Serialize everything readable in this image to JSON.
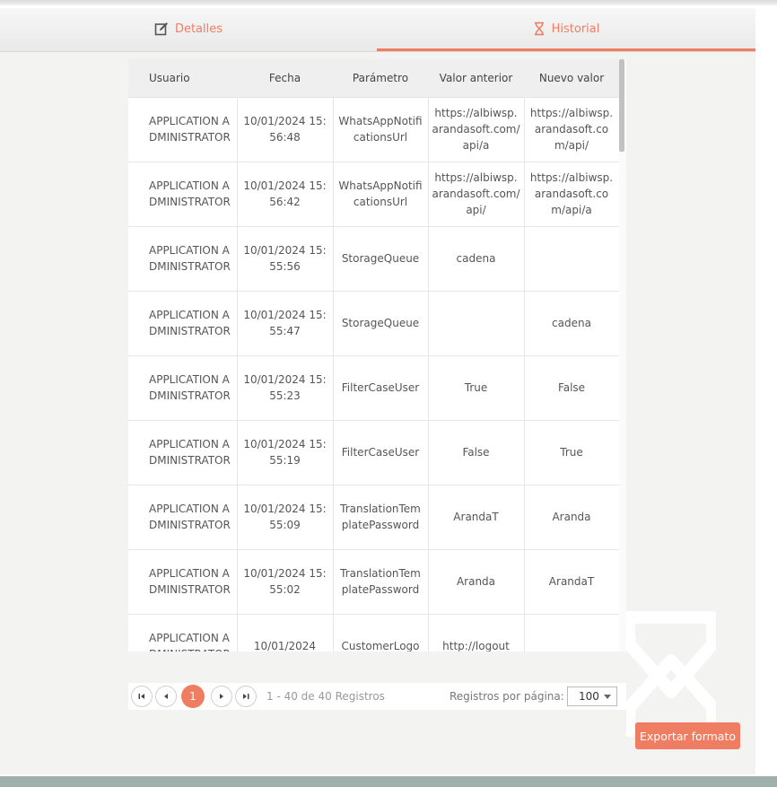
{
  "tabs": [
    {
      "label": "Detalles",
      "icon": "edit-icon"
    },
    {
      "label": "Historial",
      "icon": "hourglass-icon"
    }
  ],
  "colors": {
    "accent": "#ef7d62",
    "footer": "#9eb1ad"
  },
  "table": {
    "headers": [
      "Usuario",
      "Fecha",
      "Parámetro",
      "Valor anterior",
      "Nuevo valor"
    ],
    "rows": [
      [
        "APPLICATION ADMINISTRATOR",
        "10/01/2024 15:56:48",
        "WhatsAppNotificationsUrl",
        "https://albiwsp.arandasoft.com/api/a",
        "https://albiwsp.arandasoft.com/api/"
      ],
      [
        "APPLICATION ADMINISTRATOR",
        "10/01/2024 15:56:42",
        "WhatsAppNotificationsUrl",
        "https://albiwsp.arandasoft.com/api/",
        "https://albiwsp.arandasoft.com/api/a"
      ],
      [
        "APPLICATION ADMINISTRATOR",
        "10/01/2024 15:55:56",
        "StorageQueue",
        "cadena",
        ""
      ],
      [
        "APPLICATION ADMINISTRATOR",
        "10/01/2024 15:55:47",
        "StorageQueue",
        "",
        "cadena"
      ],
      [
        "APPLICATION ADMINISTRATOR",
        "10/01/2024 15:55:23",
        "FilterCaseUser",
        "True",
        "False"
      ],
      [
        "APPLICATION ADMINISTRATOR",
        "10/01/2024 15:55:19",
        "FilterCaseUser",
        "False",
        "True"
      ],
      [
        "APPLICATION ADMINISTRATOR",
        "10/01/2024 15:55:09",
        "TranslationTemplatePassword",
        "ArandaT",
        "Aranda"
      ],
      [
        "APPLICATION ADMINISTRATOR",
        "10/01/2024 15:55:02",
        "TranslationTemplatePassword",
        "Aranda",
        "ArandaT"
      ],
      [
        "APPLICATION ADMINISTRATOR",
        "10/01/2024",
        "CustomerLogo",
        "http://logout",
        ""
      ]
    ]
  },
  "pager": {
    "current_page": "1",
    "info": "1 - 40 de 40 Registros",
    "per_page_label": "Registros por página:",
    "per_page_value": "100",
    "buttons": [
      "first-page-icon",
      "prev-page-icon",
      "next-page-icon",
      "last-page-icon"
    ]
  },
  "export_button": "Exportar formato"
}
